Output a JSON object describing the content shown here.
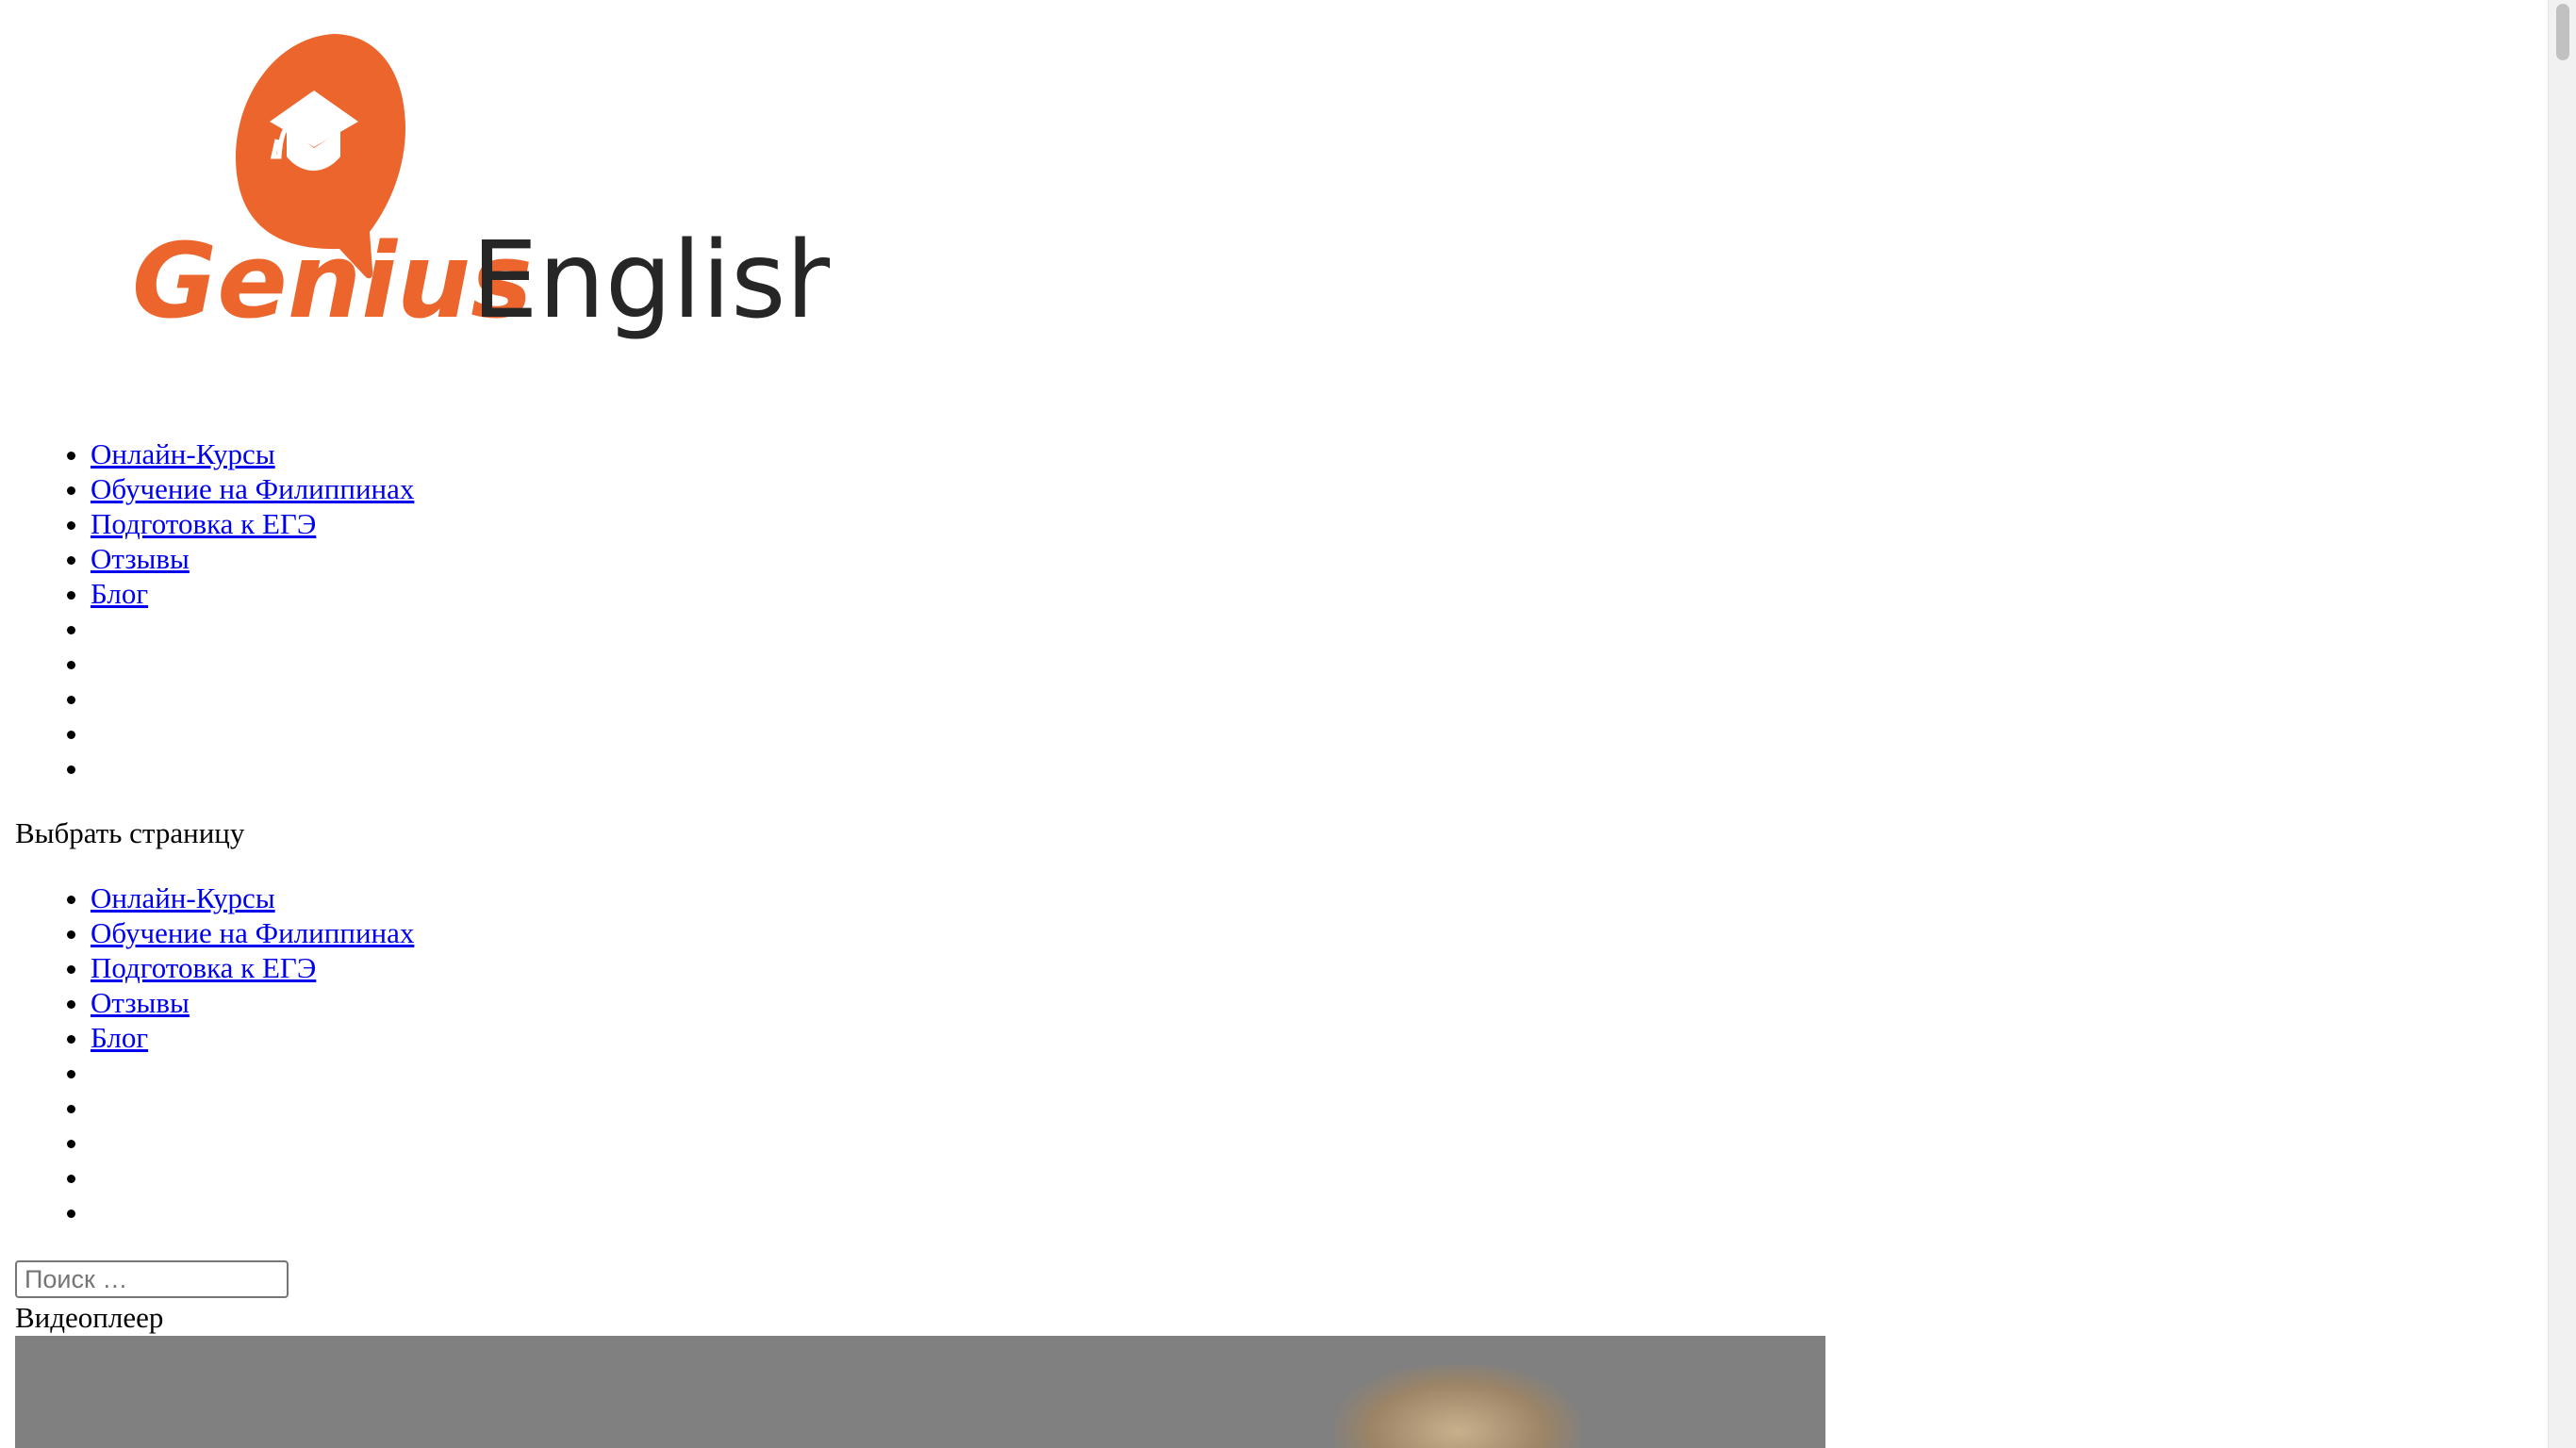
{
  "logo": {
    "word1": "Genius",
    "word2": "English",
    "accent_color": "#ec652d",
    "text_color": "#262626"
  },
  "primary_menu": {
    "items": [
      {
        "label": "Онлайн-Курсы"
      },
      {
        "label": "Обучение на Филиппинах"
      },
      {
        "label": "Подготовка к ЕГЭ"
      },
      {
        "label": "Отзывы"
      },
      {
        "label": "Блог"
      },
      {
        "label": ""
      },
      {
        "label": ""
      },
      {
        "label": ""
      },
      {
        "label": ""
      },
      {
        "label": ""
      }
    ]
  },
  "mobile_menu": {
    "select_label": "Выбрать страницу",
    "items": [
      {
        "label": "Онлайн-Курсы"
      },
      {
        "label": "Обучение на Филиппинах"
      },
      {
        "label": "Подготовка к ЕГЭ"
      },
      {
        "label": "Отзывы"
      },
      {
        "label": "Блог"
      },
      {
        "label": ""
      },
      {
        "label": ""
      },
      {
        "label": ""
      },
      {
        "label": ""
      },
      {
        "label": ""
      }
    ]
  },
  "search": {
    "placeholder": "Поиск …",
    "value": ""
  },
  "video": {
    "label": "Видеоплеер"
  }
}
